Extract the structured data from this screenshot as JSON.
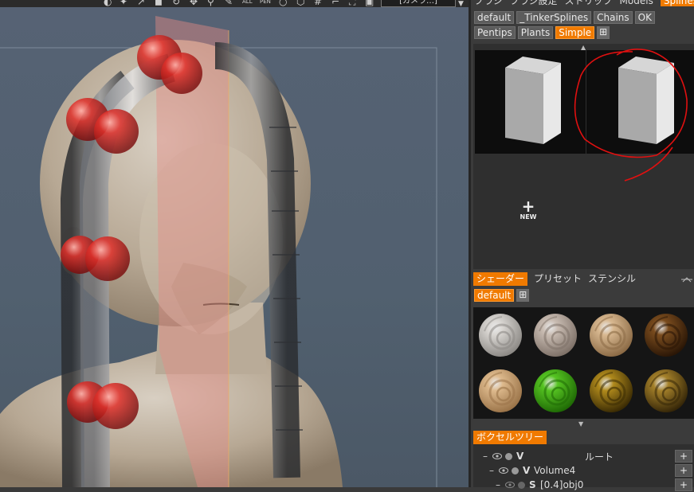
{
  "app": {
    "top_toolbar": {
      "camera_label": "[カメラ…]"
    },
    "brush_tabs": [
      "ブラシ",
      "ブラシ設定",
      "ストリップ",
      "Models",
      "Splines"
    ],
    "brush_active_tab": "Splines",
    "spline_categories": [
      "default",
      "_TinkerSplines",
      "Chains",
      "OK",
      "Pentips",
      "Plants",
      "Simple"
    ],
    "spline_active_category": "Simple",
    "new_label": "NEW",
    "shader_tabs": [
      "シェーダー",
      "プリセット",
      "ステンシル"
    ],
    "shader_active_tab": "シェーダー",
    "shader_category": "default",
    "shader_balls": [
      {
        "name": "ball-silver-1",
        "color": "#d9d6d2",
        "dark": "#8c8985"
      },
      {
        "name": "ball-silver-2",
        "color": "#c9bcb2",
        "dark": "#7e7168"
      },
      {
        "name": "ball-tan-1",
        "color": "#d8b890",
        "dark": "#8b6a45"
      },
      {
        "name": "ball-bronze",
        "color": "#7a4c1e",
        "dark": "#2a1606"
      },
      {
        "name": "ball-tan-2",
        "color": "#ddb98c",
        "dark": "#9a7348"
      },
      {
        "name": "ball-green",
        "color": "#56c422",
        "dark": "#1f6a05"
      },
      {
        "name": "ball-gold-1",
        "color": "#b08a1c",
        "dark": "#3a2b04"
      },
      {
        "name": "ball-gold-2",
        "color": "#a5812a",
        "dark": "#352608"
      }
    ],
    "voxel_tree_tab": "ボクセルツリー",
    "tree": [
      {
        "name": "ルート",
        "v": "V"
      },
      {
        "name": "Volume4",
        "v": "V"
      },
      {
        "name": "[0.4]obj0",
        "v": "S"
      }
    ],
    "colors": {
      "accent": "#f07a00",
      "panel_bg": "#3b3b3b",
      "viewport_bg": "#566274"
    }
  }
}
